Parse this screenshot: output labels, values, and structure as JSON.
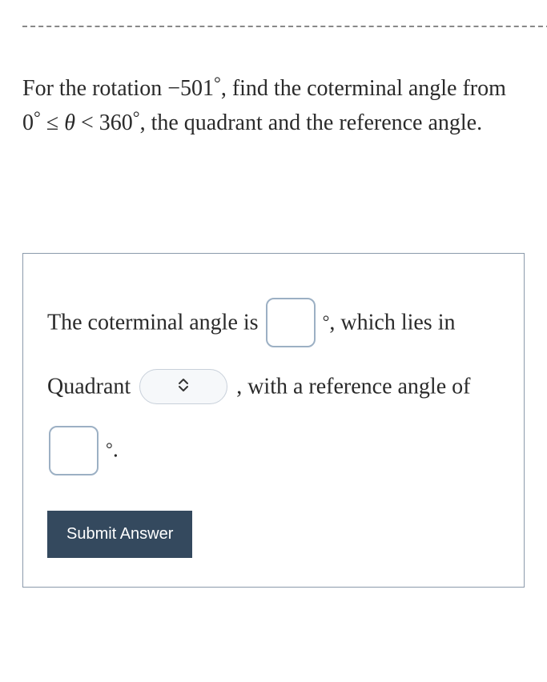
{
  "question": {
    "prefix": "For the rotation ",
    "rotation_value": "−501",
    "rotation_deg": "°",
    "mid1": ", find the coterminal angle from ",
    "range_low": "0",
    "range_low_deg": "°",
    "le": " ≤ ",
    "theta": "θ",
    "lt": " < ",
    "range_high": "360",
    "range_high_deg": "°",
    "mid2": ", the quadrant and the reference angle."
  },
  "answer": {
    "part1": "The coterminal angle is ",
    "deg1": "°",
    "part2": ", which lies in Quadrant ",
    "part3": ", with a reference angle of ",
    "deg2": "°",
    "period": "."
  },
  "inputs": {
    "coterminal_value": "",
    "quadrant_value": "",
    "reference_value": ""
  },
  "submit_label": "Submit Answer"
}
